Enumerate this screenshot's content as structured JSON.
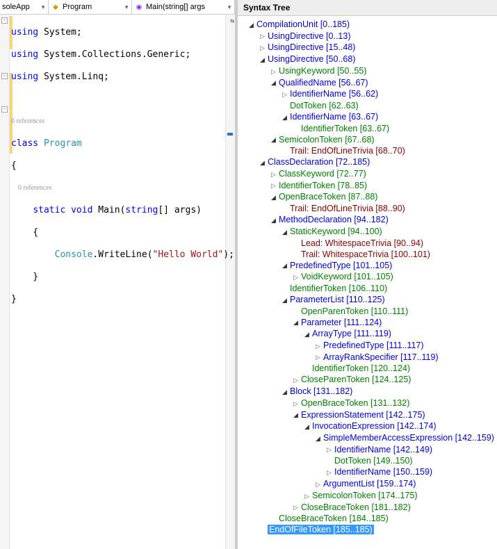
{
  "nav": {
    "scope": "soleApp",
    "type": "Program",
    "member": "Main(string[] args"
  },
  "code": {
    "l1a": "using",
    "l1b": " System;",
    "l2a": "using",
    "l2b": " System.Collections.Generic;",
    "l3a": "using",
    "l3b": " System.Linq;",
    "ref0": "0 references",
    "l5a": "class",
    "l5b": " ",
    "l5c": "Program",
    "l6": "{",
    "ref1": "    0 references",
    "l7a": "    ",
    "l7b": "static",
    "l7c": " ",
    "l7d": "void",
    "l7e": " Main(",
    "l7f": "string",
    "l7g": "[] args)",
    "l8": "    {",
    "l9a": "        ",
    "l9b": "Console",
    "l9c": ".WriteLine(",
    "l9d": "\"Hello World\"",
    "l9e": ");",
    "l10": "    }",
    "l11": "}"
  },
  "panel_title": "Syntax Tree",
  "tree": [
    {
      "d": 0,
      "e": "o",
      "c": "blue",
      "t": "CompilationUnit [0..185)"
    },
    {
      "d": 1,
      "e": "c",
      "c": "blue",
      "t": "UsingDirective [0..13)"
    },
    {
      "d": 1,
      "e": "c",
      "c": "blue",
      "t": "UsingDirective [15..48)"
    },
    {
      "d": 1,
      "e": "o",
      "c": "blue",
      "t": "UsingDirective [50..68)"
    },
    {
      "d": 2,
      "e": "c",
      "c": "green",
      "t": "UsingKeyword [50..55)"
    },
    {
      "d": 2,
      "e": "o",
      "c": "blue",
      "t": "QualifiedName [56..67)"
    },
    {
      "d": 3,
      "e": "c",
      "c": "blue",
      "t": "IdentifierName [56..62)"
    },
    {
      "d": 3,
      "e": "n",
      "c": "green",
      "t": "DotToken [62..63)"
    },
    {
      "d": 3,
      "e": "o",
      "c": "blue",
      "t": "IdentifierName [63..67)"
    },
    {
      "d": 4,
      "e": "n",
      "c": "green",
      "t": "IdentifierToken [63..67)"
    },
    {
      "d": 2,
      "e": "o",
      "c": "green",
      "t": "SemicolonToken [67..68)"
    },
    {
      "d": 3,
      "e": "n",
      "c": "darkred",
      "t": "Trail: EndOfLineTrivia [68..70)"
    },
    {
      "d": 1,
      "e": "o",
      "c": "blue",
      "t": "ClassDeclaration [72..185)"
    },
    {
      "d": 2,
      "e": "c",
      "c": "green",
      "t": "ClassKeyword [72..77)"
    },
    {
      "d": 2,
      "e": "c",
      "c": "green",
      "t": "IdentifierToken [78..85)"
    },
    {
      "d": 2,
      "e": "o",
      "c": "green",
      "t": "OpenBraceToken [87..88)"
    },
    {
      "d": 3,
      "e": "n",
      "c": "darkred",
      "t": "Trail: EndOfLineTrivia [88..90)"
    },
    {
      "d": 2,
      "e": "o",
      "c": "blue",
      "t": "MethodDeclaration [94..182)"
    },
    {
      "d": 3,
      "e": "o",
      "c": "green",
      "t": "StaticKeyword [94..100)"
    },
    {
      "d": 4,
      "e": "n",
      "c": "darkred",
      "t": "Lead: WhitespaceTrivia [90..94)"
    },
    {
      "d": 4,
      "e": "n",
      "c": "darkred",
      "t": "Trail: WhitespaceTrivia [100..101)"
    },
    {
      "d": 3,
      "e": "o",
      "c": "blue",
      "t": "PredefinedType [101..105)"
    },
    {
      "d": 4,
      "e": "c",
      "c": "green",
      "t": "VoidKeyword [101..105)"
    },
    {
      "d": 3,
      "e": "n",
      "c": "green",
      "t": "IdentifierToken [106..110)"
    },
    {
      "d": 3,
      "e": "o",
      "c": "blue",
      "t": "ParameterList [110..125)"
    },
    {
      "d": 4,
      "e": "n",
      "c": "green",
      "t": "OpenParenToken [110..111)"
    },
    {
      "d": 4,
      "e": "o",
      "c": "blue",
      "t": "Parameter [111..124)"
    },
    {
      "d": 5,
      "e": "o",
      "c": "blue",
      "t": "ArrayType [111..119)"
    },
    {
      "d": 6,
      "e": "c",
      "c": "blue",
      "t": "PredefinedType [111..117)"
    },
    {
      "d": 6,
      "e": "c",
      "c": "blue",
      "t": "ArrayRankSpecifier [117..119)"
    },
    {
      "d": 5,
      "e": "n",
      "c": "green",
      "t": "IdentifierToken [120..124)"
    },
    {
      "d": 4,
      "e": "c",
      "c": "green",
      "t": "CloseParenToken [124..125)"
    },
    {
      "d": 3,
      "e": "o",
      "c": "blue",
      "t": "Block [131..182)"
    },
    {
      "d": 4,
      "e": "c",
      "c": "green",
      "t": "OpenBraceToken [131..132)"
    },
    {
      "d": 4,
      "e": "o",
      "c": "blue",
      "t": "ExpressionStatement [142..175)"
    },
    {
      "d": 5,
      "e": "o",
      "c": "blue",
      "t": "InvocationExpression [142..174)"
    },
    {
      "d": 6,
      "e": "o",
      "c": "blue",
      "t": "SimpleMemberAccessExpression [142..159)"
    },
    {
      "d": 7,
      "e": "c",
      "c": "blue",
      "t": "IdentifierName [142..149)"
    },
    {
      "d": 7,
      "e": "n",
      "c": "green",
      "t": "DotToken [149..150)"
    },
    {
      "d": 7,
      "e": "c",
      "c": "blue",
      "t": "IdentifierName [150..159)"
    },
    {
      "d": 6,
      "e": "c",
      "c": "blue",
      "t": "ArgumentList [159..174)"
    },
    {
      "d": 5,
      "e": "c",
      "c": "green",
      "t": "SemicolonToken [174..175)"
    },
    {
      "d": 4,
      "e": "c",
      "c": "green",
      "t": "CloseBraceToken [181..182)"
    },
    {
      "d": 2,
      "e": "n",
      "c": "green",
      "t": "CloseBraceToken [184..185)"
    },
    {
      "d": 1,
      "e": "n",
      "c": "green sel",
      "t": "EndOfFileToken [185..185)"
    }
  ]
}
